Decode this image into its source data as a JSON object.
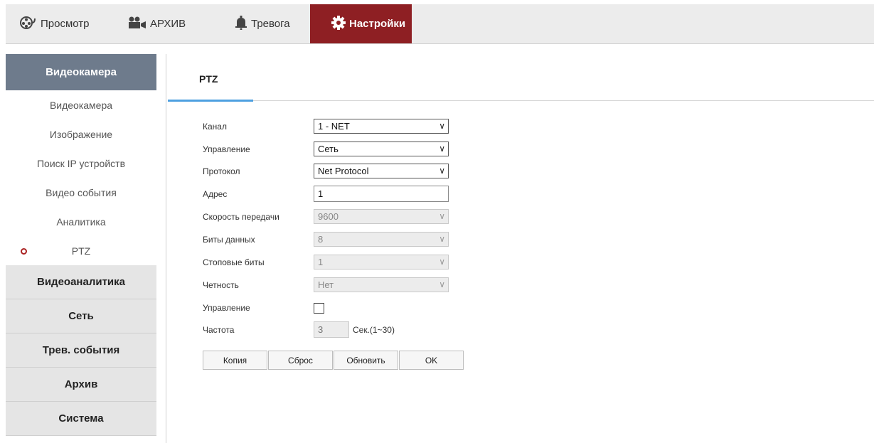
{
  "topnav": {
    "tabs": [
      {
        "label": "Просмотр",
        "icon": "camera-reel-icon"
      },
      {
        "label": "АРХИВ",
        "icon": "film-camera-icon"
      },
      {
        "label": "Тревога",
        "icon": "bell-icon"
      },
      {
        "label": "Настройки",
        "icon": "gear-icon"
      }
    ],
    "active_color": "#8e1f23"
  },
  "sidebar": {
    "header": "Видеокамера",
    "items": [
      "Видеокамера",
      "Изображение",
      "Поиск IP устройств",
      "Видео события",
      "Аналитика",
      "PTZ"
    ],
    "active_item": "PTZ",
    "groups": [
      "Видеоаналитика",
      "Сеть",
      "Трев. события",
      "Архив",
      "Система"
    ]
  },
  "content": {
    "title": "PTZ",
    "fields": {
      "channel": {
        "label": "Канал",
        "value": "1 - NET"
      },
      "control": {
        "label": "Управление",
        "value": "Сеть"
      },
      "protocol": {
        "label": "Протокол",
        "value": "Net Protocol"
      },
      "address": {
        "label": "Адрес",
        "value": "1"
      },
      "baudrate": {
        "label": "Скорость передачи",
        "value": "9600"
      },
      "databits": {
        "label": "Биты данных",
        "value": "8"
      },
      "stopbits": {
        "label": "Стоповые биты",
        "value": "1"
      },
      "parity": {
        "label": "Четность",
        "value": "Нет"
      },
      "manage": {
        "label": "Управление",
        "checked": false
      },
      "frequency": {
        "label": "Частота",
        "value": "3",
        "hint": "Сек.(1~30)"
      }
    },
    "buttons": {
      "copy": "Копия",
      "reset": "Сброс",
      "refresh": "Обновить",
      "ok": "OK"
    },
    "accent_color": "#4da0e0"
  }
}
